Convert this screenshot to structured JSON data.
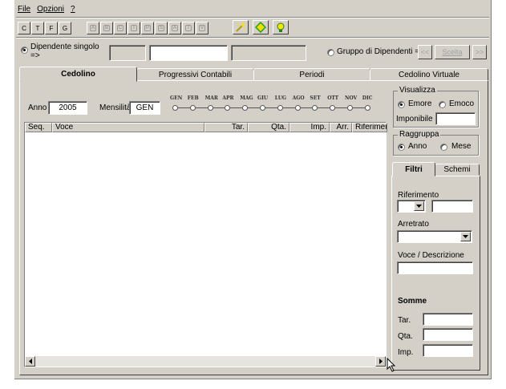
{
  "menu": {
    "file": "File",
    "opzioni": "Opzioni",
    "help": "?"
  },
  "toolbar": {
    "buttons_a": [
      "C",
      "T",
      "F",
      "G"
    ],
    "buttons_b": [
      "A",
      "B",
      "C",
      "I",
      "P",
      "S",
      "A",
      "T",
      "V"
    ]
  },
  "dipendenti": {
    "singolo_label": "Dipendente singolo",
    "singolo_arrow": "=>",
    "gruppo_label": "Gruppo di Dipendenti =>",
    "prev_label": "<<",
    "scelta_label": "Scelta",
    "next_label": ">>"
  },
  "tabs": [
    "Cedolino",
    "Progressivi Contabili",
    "Periodi",
    "Cedolino Virtuale"
  ],
  "cedolino": {
    "anno_label": "Anno",
    "anno_value": "2005",
    "mensilita_label": "Mensilità",
    "mensilita_value": "GEN",
    "months": [
      "GEN",
      "FEB",
      "MAR",
      "APR",
      "MAG",
      "GIU",
      "LUG",
      "AGO",
      "SET",
      "OTT",
      "NOV",
      "DIC"
    ]
  },
  "grid": {
    "columns": [
      "Seq.",
      "Voce",
      "Tar.",
      "Qta.",
      "Imp.",
      "Arr.",
      "Riferimento"
    ]
  },
  "visualizza": {
    "title": "Visualizza",
    "emore": "Emore",
    "emoco": "Emoco",
    "imponibile": "Imponibile"
  },
  "raggruppa": {
    "title": "Raggruppa",
    "anno": "Anno",
    "mese": "Mese"
  },
  "filtri": {
    "tab_filtri": "Filtri",
    "tab_schemi": "Schemi",
    "riferimento": "Riferimento",
    "arretrato": "Arretrato",
    "voce_descrizione": "Voce / Descrizione",
    "somme": "Somme",
    "tar": "Tar.",
    "qta": "Qta.",
    "imp": "Imp."
  }
}
